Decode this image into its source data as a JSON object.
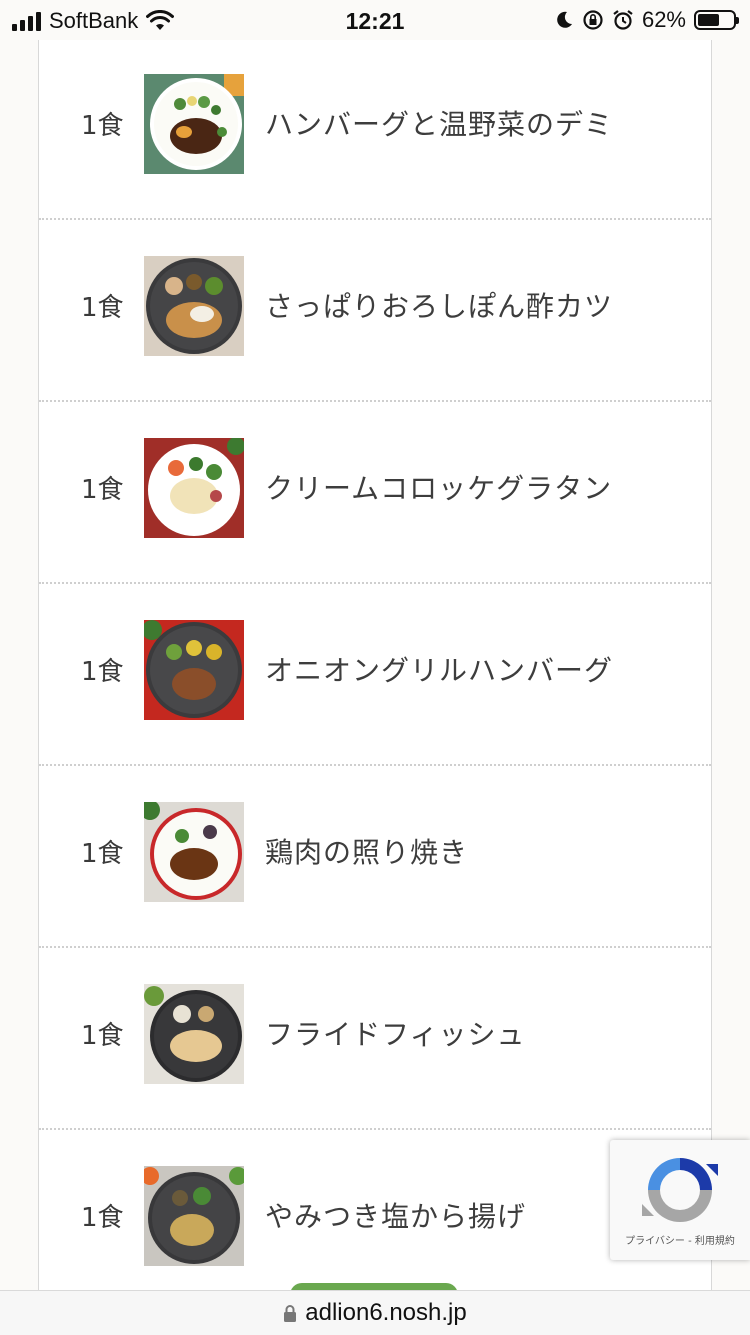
{
  "status_bar": {
    "carrier": "SoftBank",
    "time": "12:21",
    "battery_percent": "62%",
    "battery_level": 0.62
  },
  "menu_items": [
    {
      "qty": "1食",
      "name": "ハンバーグと温野菜のデミ"
    },
    {
      "qty": "1食",
      "name": "さっぱりおろしぽん酢カツ"
    },
    {
      "qty": "1食",
      "name": "クリームコロッケグラタン"
    },
    {
      "qty": "1食",
      "name": "オニオングリルハンバーグ"
    },
    {
      "qty": "1食",
      "name": "鶏肉の照り焼き"
    },
    {
      "qty": "1食",
      "name": "フライドフィッシュ"
    },
    {
      "qty": "1食",
      "name": "やみつき塩から揚げ"
    }
  ],
  "recaptcha": {
    "label": "プライバシー - 利用規約"
  },
  "address_bar": {
    "url": "adlion6.nosh.jp"
  },
  "colors": {
    "accent_green": "#6aa84f",
    "recaptcha_blue": "#4a90e2"
  }
}
